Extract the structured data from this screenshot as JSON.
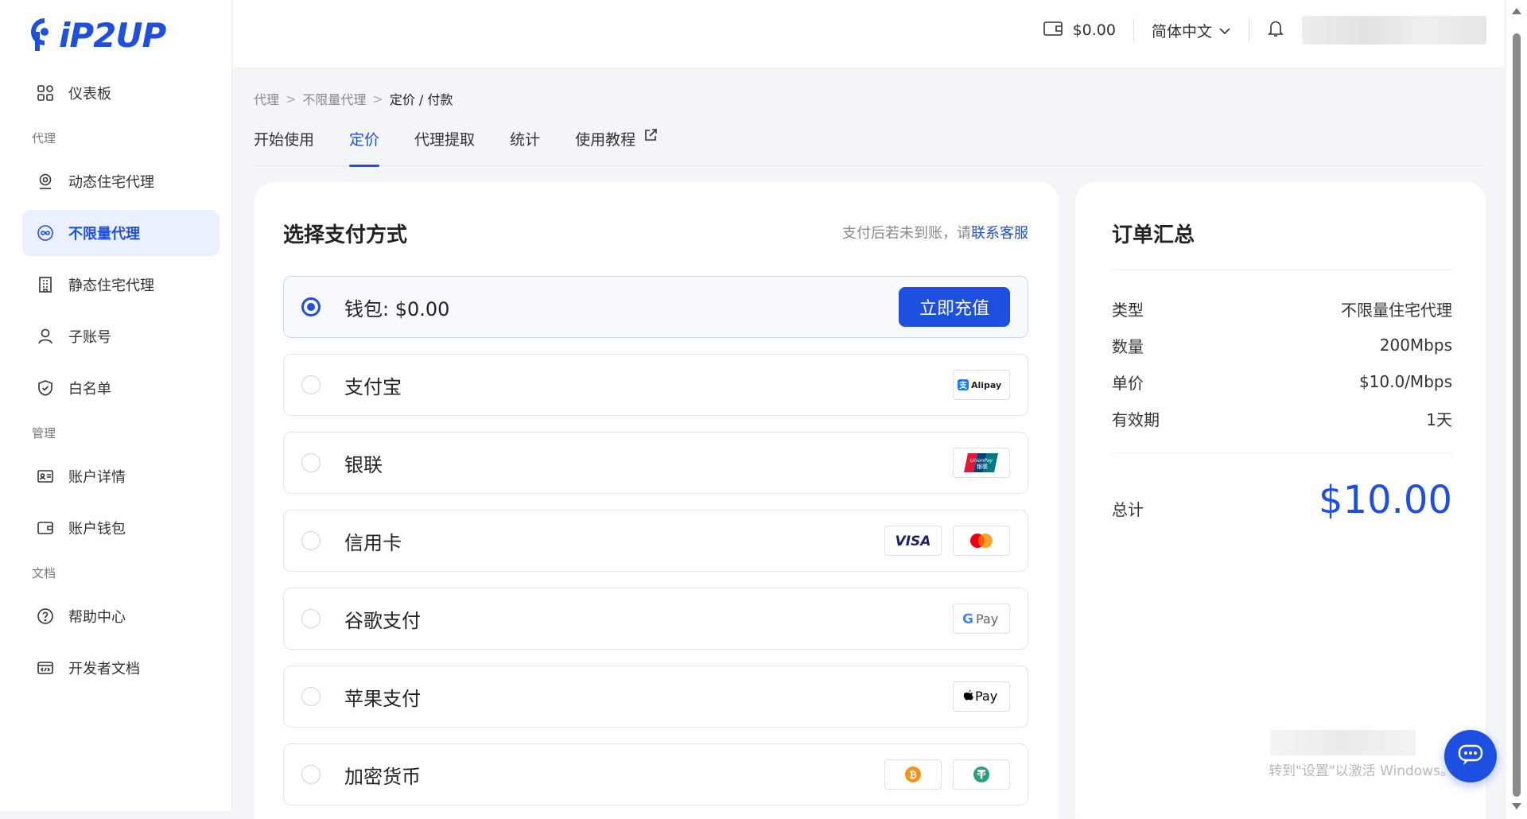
{
  "brand": {
    "logo_text": "iP2UP"
  },
  "sidebar": {
    "items": [
      {
        "label": "仪表板",
        "icon": "dashboard-icon"
      },
      {
        "section": "代理"
      },
      {
        "label": "动态住宅代理",
        "icon": "location-pin-icon"
      },
      {
        "label": "不限量代理",
        "icon": "infinity-icon",
        "active": true
      },
      {
        "label": "静态住宅代理",
        "icon": "building-icon"
      },
      {
        "label": "子账号",
        "icon": "user-icon"
      },
      {
        "label": "白名单",
        "icon": "shield-icon"
      },
      {
        "section": "管理"
      },
      {
        "label": "账户详情",
        "icon": "id-card-icon"
      },
      {
        "label": "账户钱包",
        "icon": "wallet-icon"
      },
      {
        "section": "文档"
      },
      {
        "label": "帮助中心",
        "icon": "help-icon"
      },
      {
        "label": "开发者文档",
        "icon": "code-doc-icon"
      }
    ],
    "dashboard": "仪表板",
    "section_proxy": "代理",
    "dynamic": "动态住宅代理",
    "unlimited": "不限量代理",
    "static": "静态住宅代理",
    "subaccount": "子账号",
    "whitelist": "白名单",
    "section_manage": "管理",
    "account_details": "账户详情",
    "account_wallet": "账户钱包",
    "section_docs": "文档",
    "help_center": "帮助中心",
    "dev_docs": "开发者文档"
  },
  "header": {
    "balance": "$0.00",
    "language": "简体中文"
  },
  "breadcrumb": {
    "items": [
      "代理",
      "不限量代理",
      "定价 / 付款"
    ],
    "sep": ">"
  },
  "tabs": {
    "start": "开始使用",
    "pricing": "定价",
    "extract": "代理提取",
    "stats": "统计",
    "tutorial": "使用教程",
    "active": "定价"
  },
  "payment": {
    "title": "选择支付方式",
    "note_prefix": "支付后若未到账，请",
    "note_link": "联系客服",
    "methods": {
      "wallet": "钱包: $0.00",
      "alipay": "支付宝",
      "unionpay": "银联",
      "credit": "信用卡",
      "google": "谷歌支付",
      "apple": "苹果支付",
      "crypto": "加密货币"
    },
    "recharge_label": "立即充值",
    "selected": "wallet",
    "logo_text": {
      "alipay": "Alipay",
      "unionpay": "UnionPay",
      "visa": "VISA",
      "gpay": "Pay",
      "applepay": "Pay"
    }
  },
  "order": {
    "title": "订单汇总",
    "rows": {
      "type_label": "类型",
      "type_value": "不限量住宅代理",
      "qty_label": "数量",
      "qty_value": "200Mbps",
      "price_label": "单价",
      "price_value": "$10.0/Mbps",
      "valid_label": "有效期",
      "valid_value": "1天"
    },
    "total_label": "总计",
    "total_value": "$10.00"
  },
  "watermark": "转到\"设置\"以激活 Windows。",
  "colors": {
    "accent": "#1f4fe0",
    "background": "#f3f5f9"
  }
}
